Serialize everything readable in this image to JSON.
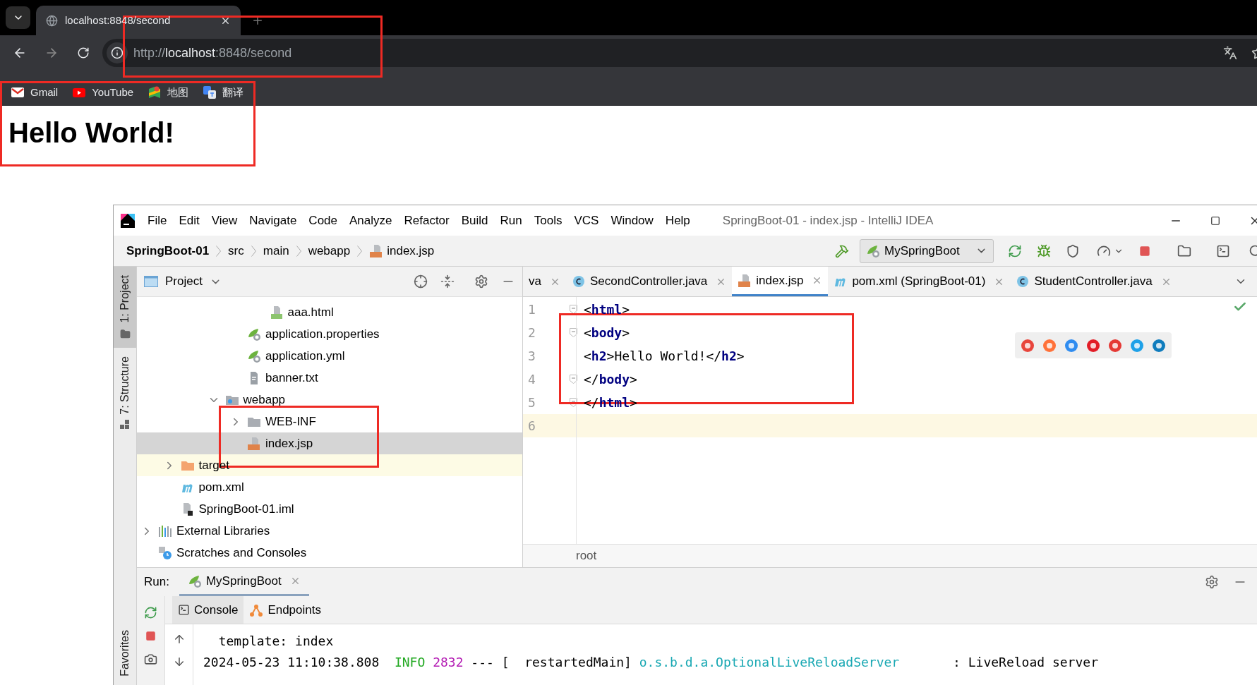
{
  "browser": {
    "tab": {
      "title": "localhost:8848/second"
    },
    "address": {
      "parts": [
        {
          "text": "http://",
          "kind": "dim"
        },
        {
          "text": "localhost",
          "kind": "host"
        },
        {
          "text": ":8848/second",
          "kind": "dim"
        }
      ]
    },
    "bookmarks": [
      {
        "label": "Gmail",
        "kind": "gmail"
      },
      {
        "label": "YouTube",
        "kind": "youtube"
      },
      {
        "label": "地图",
        "kind": "maps"
      },
      {
        "label": "翻译",
        "kind": "translate"
      }
    ],
    "page": {
      "heading": "Hello World!"
    }
  },
  "ide": {
    "title": "SpringBoot-01 - index.jsp - IntelliJ IDEA",
    "menu": [
      "File",
      "Edit",
      "View",
      "Navigate",
      "Code",
      "Analyze",
      "Refactor",
      "Build",
      "Run",
      "Tools",
      "VCS",
      "Window",
      "Help"
    ],
    "breadcrumbs": [
      {
        "label": "SpringBoot-01",
        "kind": "project"
      },
      {
        "label": "src",
        "kind": "dir"
      },
      {
        "label": "main",
        "kind": "dir"
      },
      {
        "label": "webapp",
        "kind": "dir"
      },
      {
        "label": "index.jsp",
        "kind": "jsp"
      }
    ],
    "run_config": "MySpringBoot",
    "tool_tabs": [
      {
        "label": "1: Project",
        "selected": true
      },
      {
        "label": "7: Structure",
        "selected": false
      }
    ],
    "favorites_tab": "Favorites",
    "project": {
      "title": "Project",
      "tree": [
        {
          "children": [
            {
              "children": [
                {
                  "children": [
                    {
                      "children": [
                        {
                          "children": [
                            {
                              "label": "aaa.html",
                              "kind": "html",
                              "selected": false
                            }
                          ]
                        },
                        {
                          "label": "application.properties",
                          "kind": "spring",
                          "selected": false
                        },
                        {
                          "label": "application.yml",
                          "kind": "spring",
                          "selected": false
                        },
                        {
                          "label": "banner.txt",
                          "kind": "text",
                          "selected": false
                        }
                      ]
                    },
                    {
                      "label": "webapp",
                      "kind": "webfolder",
                      "selected": false,
                      "expanded": true,
                      "children": [
                        {
                          "label": "WEB-INF",
                          "kind": "folder",
                          "selected": false,
                          "expanded": false
                        },
                        {
                          "label": "index.jsp",
                          "kind": "jsp",
                          "selected": true
                        }
                      ]
                    }
                  ]
                }
              ]
            },
            {
              "label": "target",
              "kind": "orangefolder",
              "selected": false,
              "expanded": false,
              "excluded": true
            },
            {
              "label": "pom.xml",
              "kind": "maven",
              "selected": false
            },
            {
              "label": "SpringBoot-01.iml",
              "kind": "iml",
              "selected": false
            }
          ]
        },
        {
          "label": "External Libraries",
          "kind": "libs",
          "selected": false,
          "expanded": false
        },
        {
          "label": "Scratches and Consoles",
          "kind": "scratch",
          "selected": false
        }
      ]
    },
    "editor": {
      "tabs": [
        {
          "label": "va",
          "kind": "cut",
          "selected": false
        },
        {
          "label": "SecondController.java",
          "kind": "class",
          "selected": false
        },
        {
          "label": "index.jsp",
          "kind": "jsp",
          "selected": true
        },
        {
          "label": "pom.xml (SpringBoot-01)",
          "kind": "maven",
          "selected": false
        },
        {
          "label": "StudentController.java",
          "kind": "class",
          "selected": false
        }
      ],
      "lines": [
        {
          "number": "1",
          "fold": true,
          "current": false,
          "tokens": [
            {
              "kind": "punct",
              "text": "<"
            },
            {
              "kind": "tag",
              "text": "html"
            },
            {
              "kind": "punct",
              "text": ">"
            }
          ]
        },
        {
          "number": "2",
          "fold": true,
          "current": false,
          "tokens": [
            {
              "kind": "punct",
              "text": "<"
            },
            {
              "kind": "tag",
              "text": "body"
            },
            {
              "kind": "punct",
              "text": ">"
            }
          ]
        },
        {
          "number": "3",
          "fold": false,
          "current": false,
          "tokens": [
            {
              "kind": "punct",
              "text": "<"
            },
            {
              "kind": "tag",
              "text": "h2"
            },
            {
              "kind": "punct",
              "text": ">"
            },
            {
              "kind": "text",
              "text": "Hello World!"
            },
            {
              "kind": "punct",
              "text": "</"
            },
            {
              "kind": "tag",
              "text": "h2"
            },
            {
              "kind": "punct",
              "text": ">"
            }
          ]
        },
        {
          "number": "4",
          "fold": true,
          "current": false,
          "tokens": [
            {
              "kind": "punct",
              "text": "</"
            },
            {
              "kind": "tag",
              "text": "body"
            },
            {
              "kind": "punct",
              "text": ">"
            }
          ]
        },
        {
          "number": "5",
          "fold": true,
          "current": false,
          "tokens": [
            {
              "kind": "punct",
              "text": "</"
            },
            {
              "kind": "tag",
              "text": "html"
            },
            {
              "kind": "punct",
              "text": ">"
            }
          ]
        },
        {
          "number": "6",
          "fold": false,
          "current": true
        }
      ],
      "crumb": "root"
    },
    "run": {
      "label": "Run:",
      "tab": "MySpringBoot",
      "subtabs": [
        {
          "label": "Console",
          "kind": "console",
          "selected": true
        },
        {
          "label": "Endpoints",
          "kind": "endpoints",
          "selected": false
        }
      ],
      "console": [
        {
          "tokens": [
            {
              "kind": "plain",
              "text": "  template: index"
            }
          ]
        },
        {
          "tokens": [
            {
              "kind": "plain",
              "text": "2024-05-23 11:10:38.808  "
            },
            {
              "kind": "level",
              "text": "INFO"
            },
            {
              "kind": "pid",
              "text": "2832"
            },
            {
              "kind": "plain",
              "text": " --- [  restartedMain] "
            },
            {
              "kind": "logger",
              "text": "o.s.b.d.a.OptionalLiveReloadServer"
            },
            {
              "kind": "plain",
              "text": "       : LiveReload server"
            }
          ]
        }
      ]
    }
  }
}
